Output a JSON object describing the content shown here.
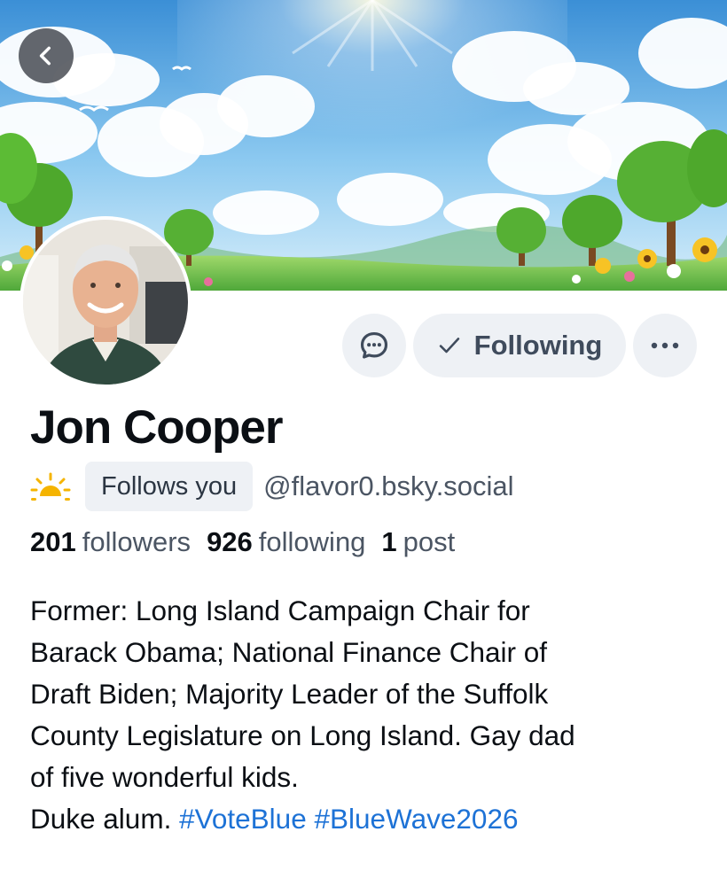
{
  "profile": {
    "display_name": "Jon Cooper",
    "follows_you_label": "Follows you",
    "handle": "@flavor0.bsky.social"
  },
  "actions": {
    "following_label": "Following",
    "following_check": "✓"
  },
  "stats": {
    "followers_count": "201",
    "followers_label": "followers",
    "following_count": "926",
    "following_label": "following",
    "posts_count": "1",
    "posts_label": "post"
  },
  "bio": {
    "line1": "Former: Long Island Campaign Chair for",
    "line2": "Barack Obama; National Finance Chair of",
    "line3": "Draft Biden; Majority Leader of the Suffolk",
    "line4": "County Legislature on Long Island. Gay dad",
    "line5": "of five wonderful kids.",
    "line6_text": "Duke alum.",
    "hashtag1": "#VoteBlue",
    "hashtag2": "#BlueWave2026"
  },
  "icons": {
    "back": "chevron-left-icon",
    "chat": "chat-bubble-icon",
    "more": "ellipsis-icon",
    "status": "sunrise-icon"
  },
  "colors": {
    "accent_link": "#1d72d6",
    "button_bg": "#eef1f5",
    "text_primary": "#0b0f14",
    "text_secondary": "#4b5563"
  }
}
